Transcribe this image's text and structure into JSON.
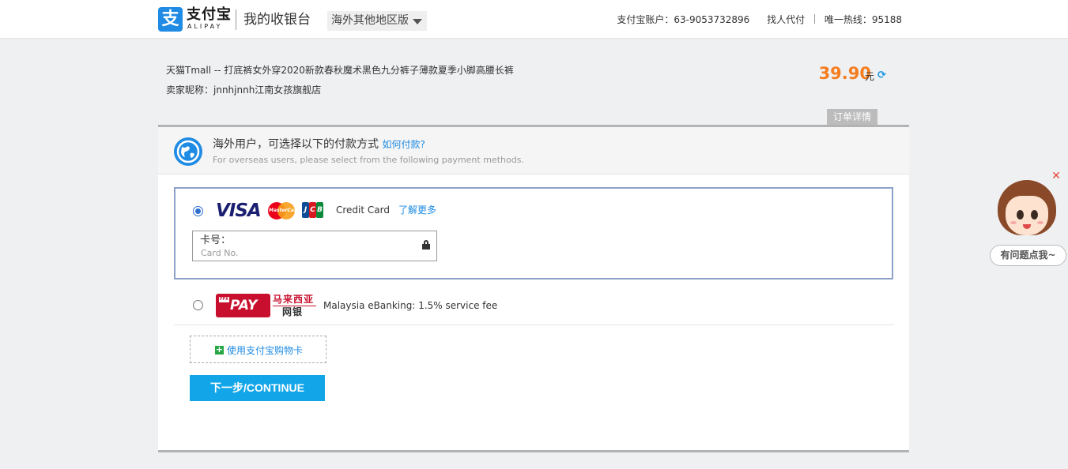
{
  "header": {
    "logo_cn": "支付宝",
    "logo_en": "ALIPAY",
    "cashier_title": "我的收银台",
    "region_selector": "海外其他地区版",
    "account_label": "支付宝账户：63-9053732896",
    "proxy_pay": "找人代付",
    "hotline": "唯一热线：95188"
  },
  "order": {
    "title": "天猫Tmall -- 打底裤女外穿2020新款春秋魔术黑色九分裤子薄款夏季小脚高腰长裤",
    "seller": "卖家昵称：jnnhjnnh江南女孩旗舰店",
    "amount": "39.90",
    "currency": "元",
    "detail_tab": "订单详情"
  },
  "notice": {
    "cn_text": "海外用户，可选择以下的付款方式",
    "how_to_pay": "如何付款?",
    "en_text": "For overseas users, please select from the following payment methods."
  },
  "payment_methods": {
    "credit_card": {
      "label": "Credit Card",
      "learn_more": "了解更多",
      "card_label": "卡号：",
      "card_placeholder": "Card No.",
      "visa_text": "VISA",
      "mastercard_text": "MasterCard",
      "jcb_letters": [
        "J",
        "C",
        "B"
      ]
    },
    "fpx": {
      "brand": "PAY",
      "brand_prefix": "FPX",
      "cn_line1": "马来西亚",
      "cn_line2": "网银",
      "label": "Malaysia eBanking: 1.5% service fee"
    },
    "gift_card": "使用支付宝购物卡"
  },
  "next_button": "下一步/CONTINUE",
  "helper": {
    "bubble": "有问题点我~"
  },
  "colors": {
    "alipay_blue": "#1f8be4",
    "amount_orange": "#f57d1f",
    "button_blue": "#12a5e8",
    "selected_border": "#8ca2c8"
  }
}
